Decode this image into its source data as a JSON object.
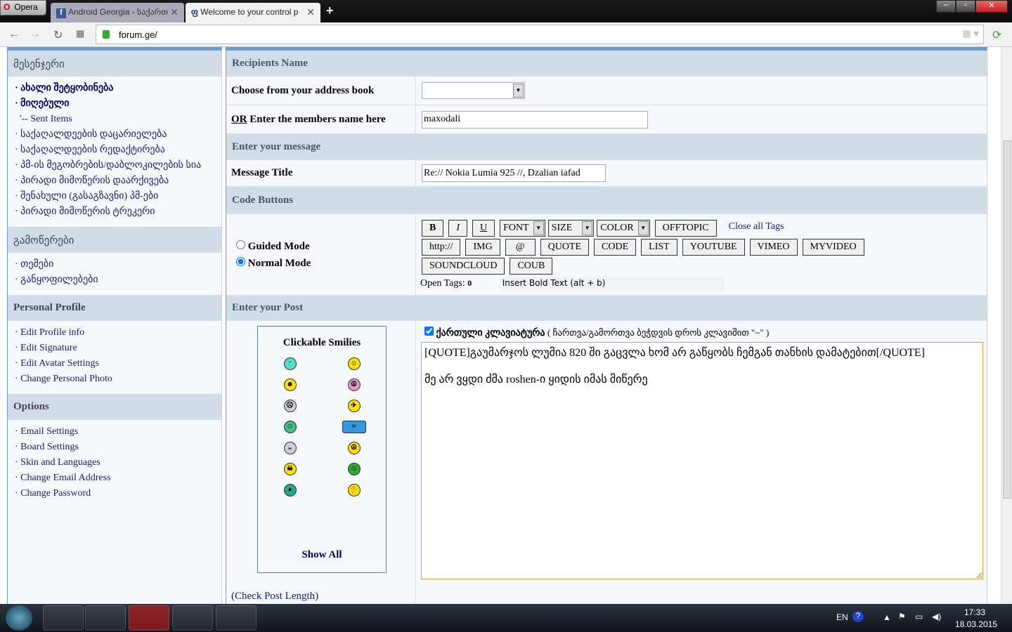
{
  "browser": {
    "opera_label": "Opera",
    "tabs": [
      {
        "label": "Android Georgia - საქართ"
      },
      {
        "label": "Welcome to your control p"
      }
    ],
    "url": "forum.ge/"
  },
  "sidebar": {
    "sections": [
      {
        "title": "მესენჯერი",
        "items": [
          "ახალი შეტყობინება",
          "მიღებული",
          "'-- Sent Items",
          "საქაღალდეების დაცარიელება",
          "საქაღალდეების რედაქტირება",
          "პმ-ის მეგობრების/დაბლოკილების სია",
          "პირადი მიმოწერის დაარქივება",
          "შენახული (გასაგზავნი) პმ-ები",
          "პირადი მიმოწერის ტრეკერი"
        ]
      },
      {
        "title": "გამოწერები",
        "items": [
          "თემები",
          "განყოფილებები"
        ]
      },
      {
        "title": "Personal Profile",
        "items": [
          "Edit Profile info",
          "Edit Signature",
          "Edit Avatar Settings",
          "Change Personal Photo"
        ]
      },
      {
        "title": "Options",
        "items": [
          "Email Settings",
          "Board Settings",
          "Skin and Languages",
          "Change Email Address",
          "Change Password"
        ]
      }
    ]
  },
  "form": {
    "recipients_header": "Recipients Name",
    "address_book_label": "Choose from your address book",
    "or_label": "OR",
    "members_label": "Enter the members name here",
    "members_value": "maxodali",
    "message_header": "Enter your message",
    "title_label": "Message Title",
    "title_value": "Re:// Nokia Lumia 925 //, Dzalian iafad",
    "code_header": "Code Buttons",
    "guided_mode": "Guided Mode",
    "normal_mode": "Normal Mode",
    "buttons_row1": [
      "B",
      "I",
      "U"
    ],
    "dropdowns": [
      "FONT",
      "SIZE",
      "COLOR"
    ],
    "offtopic": "OFFTOPIC",
    "close_tags": "Close all Tags",
    "buttons_row2": [
      "http://",
      "IMG",
      "@",
      "QUOTE",
      "CODE",
      "LIST",
      "YOUTUBE",
      "VIMEO",
      "MYVIDEO"
    ],
    "buttons_row3": [
      "SOUNDCLOUD",
      "COUB"
    ],
    "open_tags_label": "Open Tags:",
    "open_tags_value": "0",
    "hint": "Insert Bold Text (alt + b)",
    "post_header": "Enter your Post",
    "smilies_title": "Clickable Smilies",
    "show_all": "Show All",
    "check_length": "(Check Post Length)",
    "keyboard_label": "ქართული კლავიატურა",
    "keyboard_hint": "( ჩართვა/გამორთვა ბეჭდვის დროს კლავიშით \"~\" )",
    "post_value": "[QUOTE]გაუმარჯოს ლუმია 820 ში გაცვლა ხომ არ გაწყობს ჩემგან თანხის დამატებით[/QUOTE]\n\nმე არ ვყდი ძმა roshen-ი ყიდის იმას მიწერე"
  },
  "taskbar": {
    "lang": "EN",
    "time": "17:33",
    "date": "18.03.2015"
  }
}
